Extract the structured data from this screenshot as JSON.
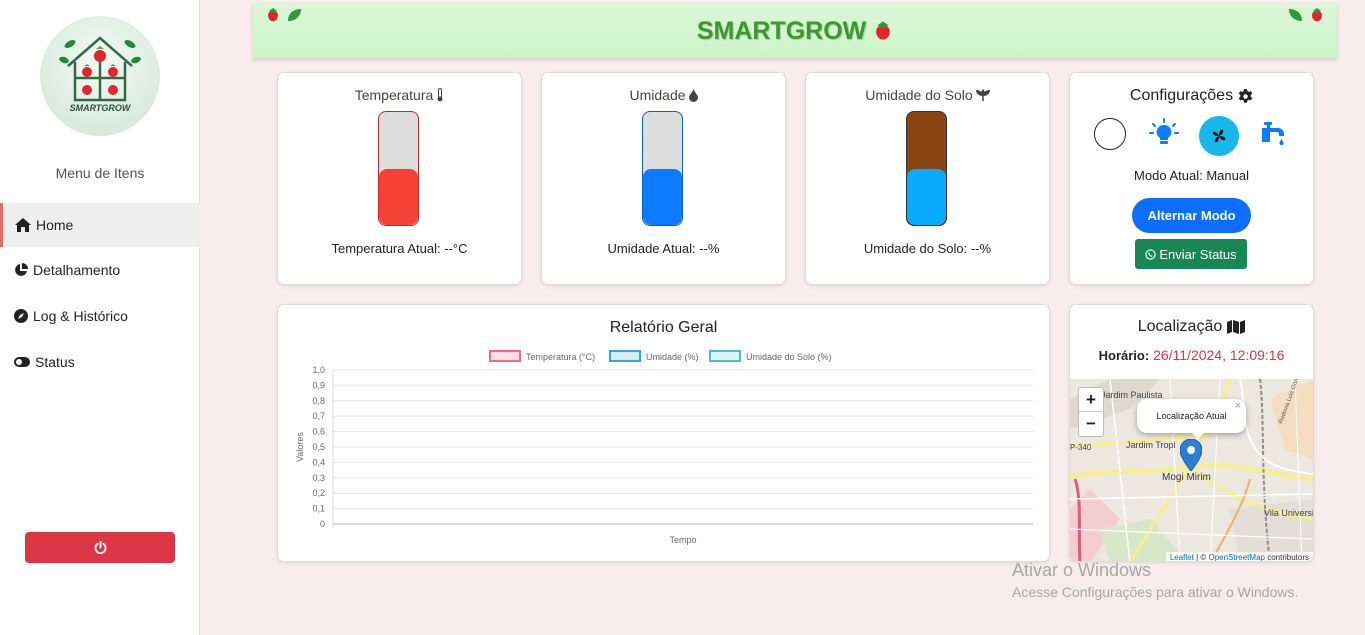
{
  "sidebar": {
    "logo_text": "SMARTGROW",
    "menu_title": "Menu de Itens",
    "items": [
      {
        "label": "Home",
        "icon": "home-icon"
      },
      {
        "label": "Detalhamento",
        "icon": "pie-chart-icon"
      },
      {
        "label": "Log & Histórico",
        "icon": "compass-icon"
      },
      {
        "label": "Status",
        "icon": "toggle-icon"
      }
    ],
    "power_icon": "power-icon"
  },
  "header": {
    "title": "SMARTGROW",
    "accent_color": "#3a9a2e"
  },
  "sensors": [
    {
      "title": "Temperatura",
      "icon": "thermometer-icon",
      "value_text": "Temperatura Atual: --°C",
      "level": 0.5,
      "color": "#f44336",
      "border": "#c62828"
    },
    {
      "title": "Umidade",
      "icon": "droplet-icon",
      "value_text": "Umidade Atual: --%",
      "level": 0.5,
      "color": "#0d7bff",
      "border": "#0a5fc4"
    },
    {
      "title": "Umidade do Solo",
      "icon": "seedling-icon",
      "value_text": "Umidade do Solo: --%",
      "level": 0.5,
      "color": "#0aabff",
      "top_color": "#8b4513"
    }
  ],
  "config": {
    "title": "Configurações",
    "title_icon": "gear-icon",
    "icons": [
      "circle-toggle-icon",
      "lightbulb-icon",
      "fan-icon",
      "faucet-icon"
    ],
    "mode_text": "Modo Atual: Manual",
    "toggle_button": "Alternar Modo",
    "status_button": "Enviar Status"
  },
  "report": {
    "title": "Relatório Geral"
  },
  "chart_data": {
    "type": "line",
    "title": "Relatório Geral",
    "xlabel": "Tempo",
    "ylabel": "Valores",
    "ylim": [
      0,
      1
    ],
    "y_ticks": [
      "1,0",
      "0,9",
      "0,8",
      "0,7",
      "0,6",
      "0,5",
      "0,4",
      "0,3",
      "0,2",
      "0,1",
      "0"
    ],
    "categories": [],
    "series": [
      {
        "name": "Temperatura (°C)",
        "values": [],
        "color": "#ff6384"
      },
      {
        "name": "Umidade (%)",
        "values": [],
        "color": "#36a2eb"
      },
      {
        "name": "Umidade do Solo (%)",
        "values": [],
        "color": "#4bc0c0"
      }
    ],
    "legend": "top",
    "grid": true
  },
  "location": {
    "title": "Localização",
    "title_icon": "map-icon",
    "time_label": "Horário:",
    "time_value": "26/11/2024, 12:09:16",
    "map": {
      "labels": [
        "Jardim Paulista",
        "Jardim Tropi",
        "Mogi Mirim",
        "Vila Universitá",
        "P-340",
        "Rodovia Luiz Gonzaga"
      ],
      "popup": "Localização Atual",
      "zoom_in": "+",
      "zoom_out": "−",
      "attribution_leaflet": "Leaflet",
      "attribution_sep": " | © ",
      "attribution_osm": "OpenStreetMap",
      "attribution_tail": " contributors"
    }
  },
  "watermark": {
    "line1": "Ativar o Windows",
    "line2": "Acesse Configurações para ativar o Windows."
  }
}
